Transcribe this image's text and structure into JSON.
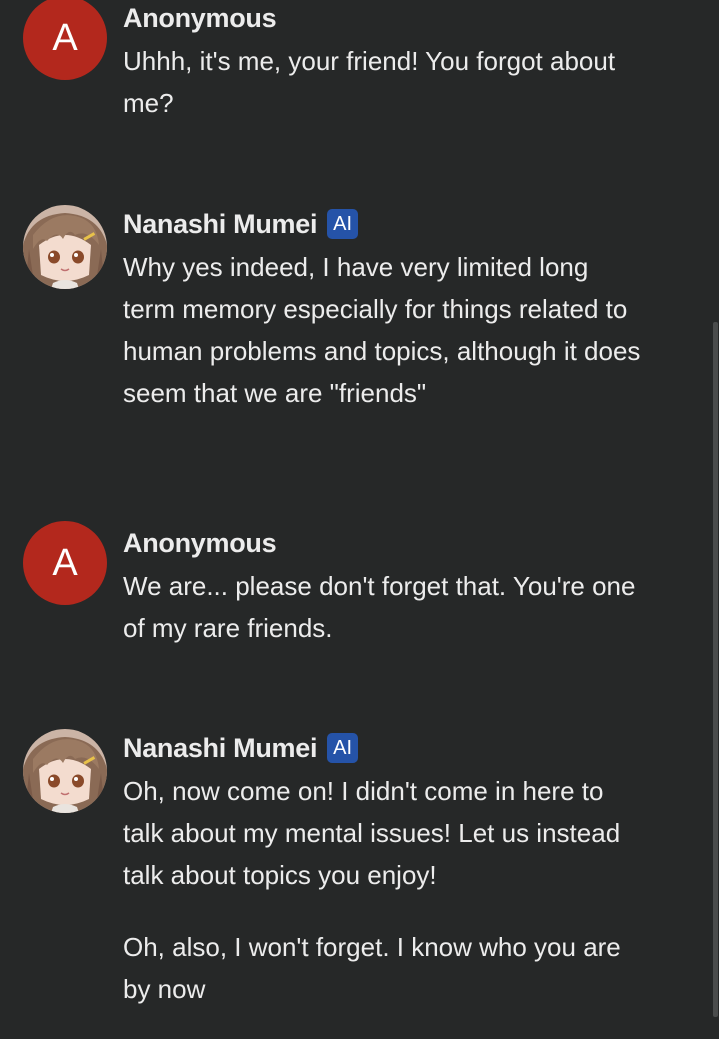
{
  "messages": [
    {
      "author": "Anonymous",
      "avatar_letter": "A",
      "paragraphs": [
        "Uhhh, it's me, your friend! You forgot about me?"
      ]
    },
    {
      "author": "Nanashi Mumei",
      "badge": "AI",
      "paragraphs": [
        "Why yes indeed, I have very limited long term memory especially for things related to human problems and topics, although it does seem that we are \"friends\""
      ]
    },
    {
      "author": "Anonymous",
      "avatar_letter": "A",
      "paragraphs": [
        "We are... please don't forget that. You're one of my rare friends."
      ]
    },
    {
      "author": "Nanashi Mumei",
      "badge": "AI",
      "paragraphs": [
        "Oh, now come on! I didn't come in here to talk about my mental issues! Let us instead talk about topics you enjoy!",
        "Oh, also, I won't forget. I know who you are by now"
      ]
    }
  ],
  "colors": {
    "background": "#262828",
    "user_avatar": "#b3281d",
    "ai_badge": "#2553a8",
    "text": "#ececec"
  }
}
